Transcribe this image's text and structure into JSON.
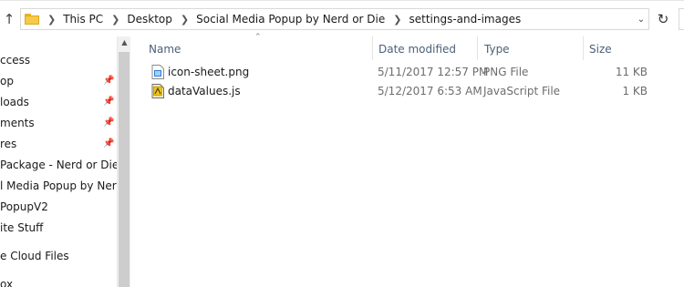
{
  "address": {
    "crumbs": [
      "This PC",
      "Desktop",
      "Social Media Popup by Nerd or Die",
      "settings-and-images"
    ]
  },
  "nav": {
    "items": [
      {
        "label": "ccess",
        "pinned": false
      },
      {
        "label": "op",
        "pinned": true
      },
      {
        "label": "loads",
        "pinned": true
      },
      {
        "label": "ments",
        "pinned": true
      },
      {
        "label": "res",
        "pinned": true
      },
      {
        "label": " Package - Nerd or Die",
        "pinned": false
      },
      {
        "label": "l Media Popup by Nerd or",
        "pinned": false
      },
      {
        "label": "PopupV2",
        "pinned": false
      },
      {
        "label": "ite Stuff",
        "pinned": false
      },
      {
        "label": "e Cloud Files",
        "pinned": false
      },
      {
        "label": "ox",
        "pinned": false
      }
    ]
  },
  "list": {
    "columns": {
      "name": "Name",
      "date": "Date modified",
      "type": "Type",
      "size": "Size"
    },
    "files": [
      {
        "name": "icon-sheet.png",
        "date": "5/11/2017 12:57 PM",
        "type": "PNG File",
        "size": "11 KB",
        "icon": "png-file-icon"
      },
      {
        "name": "dataValues.js",
        "date": "5/12/2017 6:53 AM",
        "type": "JavaScript File",
        "size": "1 KB",
        "icon": "js-file-icon"
      }
    ]
  },
  "icons": {
    "up": "up-arrow-icon",
    "folder": "folder-icon",
    "separator": "chevron-right-icon",
    "dropdown": "chevron-down-icon",
    "refresh": "refresh-icon",
    "pin": "pin-icon",
    "sort": "sort-ascending-icon"
  },
  "colors": {
    "header_text": "#4c607a",
    "detail_text": "#6d6d6d",
    "border": "#d9d9d9",
    "folder": "#f7c948"
  }
}
